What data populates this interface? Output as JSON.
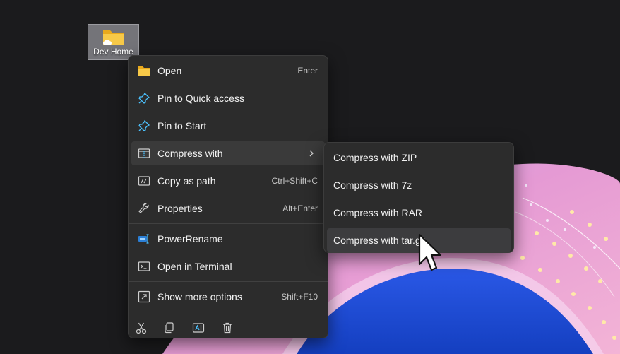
{
  "desktop": {
    "folder_label": "Dev Home"
  },
  "context_menu": {
    "items": [
      {
        "label": "Open",
        "shortcut": "Enter",
        "icon": "folder-icon"
      },
      {
        "label": "Pin to Quick access",
        "shortcut": "",
        "icon": "pin-icon"
      },
      {
        "label": "Pin to Start",
        "shortcut": "",
        "icon": "pin-icon"
      },
      {
        "label": "Compress with",
        "shortcut": "",
        "icon": "archive-icon",
        "has_submenu": true
      },
      {
        "label": "Copy as path",
        "shortcut": "Ctrl+Shift+C",
        "icon": "path-icon"
      },
      {
        "label": "Properties",
        "shortcut": "Alt+Enter",
        "icon": "wrench-icon"
      },
      {
        "label": "PowerRename",
        "shortcut": "",
        "icon": "powerrename-icon"
      },
      {
        "label": "Open in Terminal",
        "shortcut": "",
        "icon": "terminal-icon"
      },
      {
        "label": "Show more options",
        "shortcut": "Shift+F10",
        "icon": "more-options-icon"
      }
    ],
    "action_bar": [
      "cut-icon",
      "copy-icon",
      "rename-icon",
      "delete-icon"
    ]
  },
  "submenu": {
    "items": [
      {
        "label": "Compress with ZIP"
      },
      {
        "label": "Compress with 7z"
      },
      {
        "label": "Compress with RAR"
      },
      {
        "label": "Compress with tar.gz"
      }
    ],
    "highlighted_index": 3
  },
  "colors": {
    "menu_bg": "#2c2c2c",
    "highlight_bg": "#3a3a3a",
    "accent_blue": "#4cc2ff",
    "folder_yellow": "#f7c948"
  }
}
